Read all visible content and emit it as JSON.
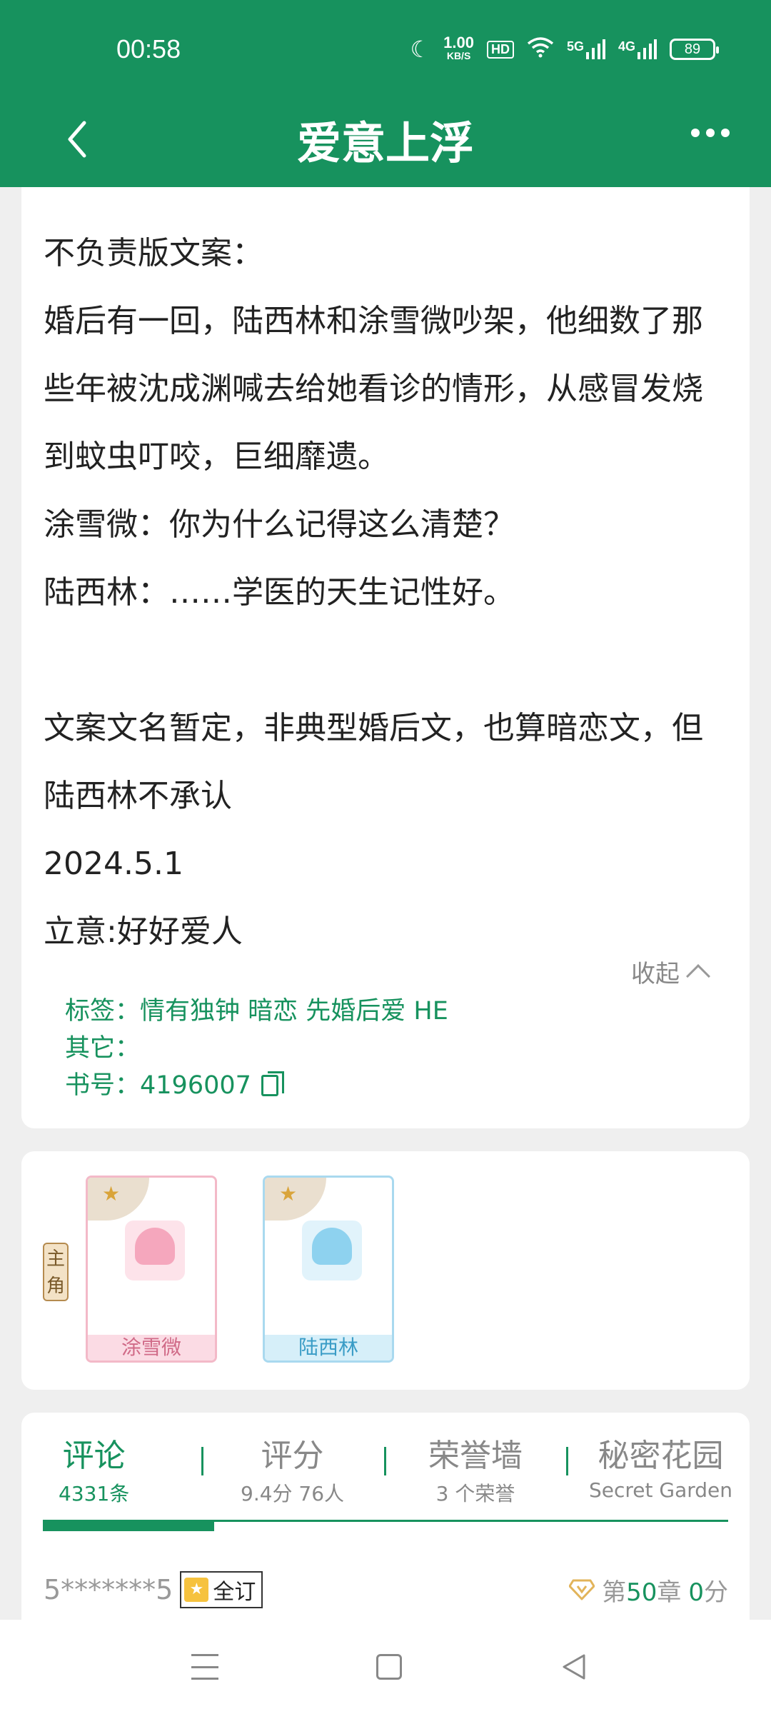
{
  "status_bar": {
    "time": "00:58",
    "net_speed": "1.00",
    "net_unit": "KB/S",
    "hd": "HD",
    "net1": "5G",
    "net2": "4G",
    "battery": "89"
  },
  "header": {
    "title": "爱意上浮",
    "back_icon": "chevron-left-icon",
    "more_icon": "more-dots-icon"
  },
  "description": {
    "lines": [
      "不负责版文案：",
      "婚后有一回，陆西林和涂雪微吵架，他细数了那",
      "些年被沈成渊喊去给她看诊的情形，从感冒发烧",
      "到蚊虫叮咬，巨细靡遗。",
      "涂雪微：你为什么记得这么清楚？",
      "陆西林：……学医的天生记性好。",
      "",
      "文案文名暂定，非典型婚后文，也算暗恋文，但",
      "陆西林不承认",
      "2024.5.1",
      "立意:好好爱人"
    ],
    "collapse_label": "收起",
    "tags_label": "标签：",
    "tags": "情有独钟 暗恋 先婚后爱 HE",
    "other_label": "其它：",
    "other": "",
    "book_no_label": "书号：",
    "book_no": "4196007"
  },
  "characters": {
    "role_tag": "主角",
    "items": [
      {
        "name": "涂雪微"
      },
      {
        "name": "陆西林"
      }
    ]
  },
  "tabs": [
    {
      "title": "评论",
      "sub": "4331条",
      "active": true
    },
    {
      "title": "评分",
      "sub": "9.4分 76人",
      "active": false
    },
    {
      "title": "荣誉墙",
      "sub": "3 个荣誉",
      "active": false
    },
    {
      "title": "秘密花园",
      "sub": "Secret Garden",
      "active": false
    }
  ],
  "review": {
    "user": "5*******5",
    "badge": "全订",
    "chapter_prefix": "第",
    "chapter_num": "50",
    "chapter_suffix": "章",
    "score_num": "0",
    "score_suffix": "分"
  },
  "colors": {
    "brand": "#17925e",
    "muted": "#888888"
  }
}
